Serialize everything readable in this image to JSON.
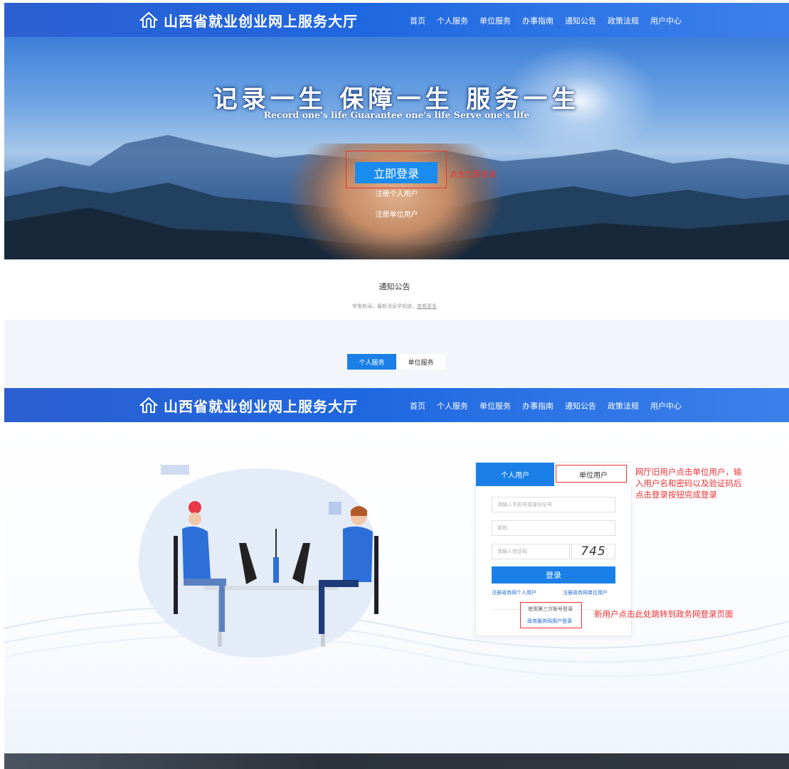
{
  "header": {
    "title": "山西省就业创业网上服务大厅",
    "nav": [
      "首页",
      "个人服务",
      "单位服务",
      "办事指南",
      "通知公告",
      "政策法规",
      "用户中心"
    ]
  },
  "hero": {
    "slogan": "记录一生  保障一生  服务一生",
    "slogan_en": "Record one's life  Guarantee one's life  Serve one's life",
    "login_label": "立即登录",
    "annotation": "点击立即登录",
    "register_personal": "注册个人用户",
    "register_company": "注册单位用户"
  },
  "notices": {
    "title": "通知公告",
    "subtitle": "常看新闻，最新消息早知道，",
    "more_link": "查看更多"
  },
  "services": {
    "tabs": [
      "个人服务",
      "单位服务"
    ]
  },
  "login": {
    "tab_personal": "个人用户",
    "tab_company": "单位用户",
    "id_placeholder": "请输入手机号或身份证号",
    "password_placeholder": "密码",
    "captcha_placeholder": "请输入验证码",
    "captcha_value": "745",
    "submit_label": "登录",
    "register_personal_link": "注册政务网个人用户",
    "register_company_link": "注册政务网单位用户",
    "third_party_label": "使用第三方账号登录",
    "gov_login_link": "政务服务网用户登录"
  },
  "annotations": {
    "company_tip": "网厅旧用户点击单位用户，输入用户名和密码以及验证码后点击登录按钮完成登录",
    "gov_tip": "新用户点击此处跳转到政务网登录页面"
  },
  "colors": {
    "primary": "#1a80e8",
    "annotation": "#ee3333",
    "header": "#1f67e0"
  }
}
